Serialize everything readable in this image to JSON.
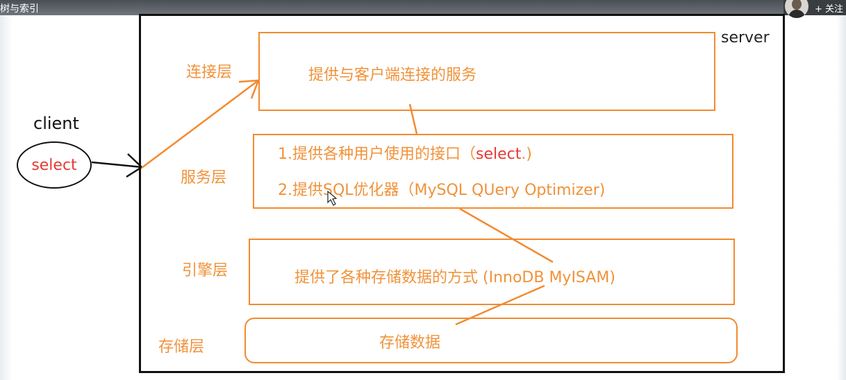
{
  "video": {
    "title": "树与索引",
    "follow_label": "+ 关注"
  },
  "diagram": {
    "server_label": "server",
    "client_label": "client",
    "client_action": "select",
    "layers": [
      {
        "label": "连接层",
        "lines": [
          "提供与客户端连接的服务"
        ]
      },
      {
        "label": "服务层",
        "lines": [
          "1.提供各种用户使用的接口（",
          "select",
          ".)",
          "2.提供SQL优化器（MySQL QUery Optimizer)"
        ]
      },
      {
        "label": "引擎层",
        "lines": [
          "提供了各种存储数据的方式 (InnoDB  MyISAM)"
        ]
      },
      {
        "label": "存储层",
        "lines": [
          "存储数据"
        ]
      }
    ]
  },
  "colors": {
    "orange": "#f28a2e",
    "red": "#e53935",
    "black": "#111111"
  }
}
